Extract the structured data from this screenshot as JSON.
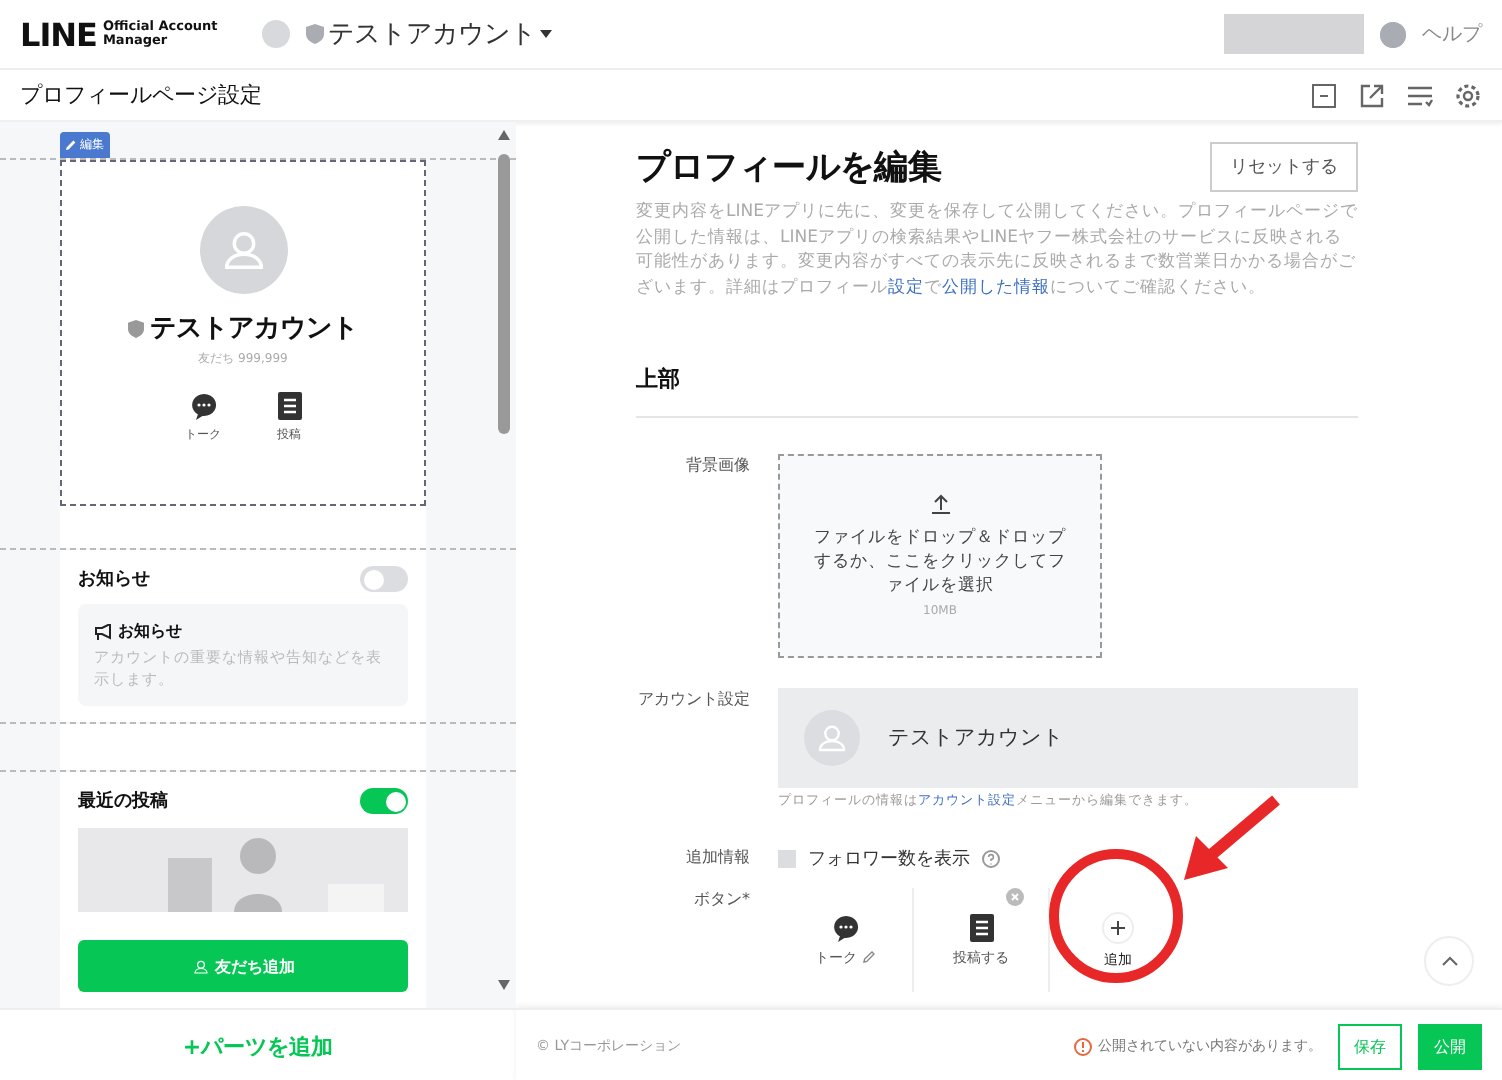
{
  "header": {
    "logo": "LINE",
    "logo_sub": [
      "Official Account",
      "Manager"
    ],
    "account_name": "テストアカウント",
    "help": "ヘルプ"
  },
  "subheader": {
    "title": "プロフィールページ設定"
  },
  "preview": {
    "edit_badge": "編集",
    "profile_name": "テストアカウント",
    "friends": "友だち 999,999",
    "actions": [
      {
        "label": "トーク",
        "kind": "chat"
      },
      {
        "label": "投稿",
        "kind": "post"
      }
    ],
    "notice": {
      "title": "お知らせ",
      "on": false,
      "card_title": "お知らせ",
      "card_text": "アカウントの重要な情報や告知などを表示します。"
    },
    "recent": {
      "title": "最近の投稿",
      "on": true
    },
    "add_friend": "友だち追加"
  },
  "add_parts": "+パーツを追加",
  "editor": {
    "title": "プロフィールを編集",
    "reset": "リセットする",
    "description": [
      {
        "kind": "text",
        "text": "変更内容をLINEアプリに先に、変更を保存して公開してください。プロフィールページで公開した情報は、LINEアプリの検索結果やLINEヤフー株式会社のサービスに反映される可能性があります。変更内容がすべての表示先に反映されるまで数営業日かかる場合がございます。詳細はプロフィール"
      },
      {
        "kind": "link",
        "text": "設定"
      },
      {
        "kind": "text",
        "text": "で"
      },
      {
        "kind": "link",
        "text": "公開した情報"
      },
      {
        "kind": "text",
        "text": "についてご確認ください。"
      }
    ],
    "section": "上部",
    "background_label": "背景画像",
    "dropzone_text": "ファイルをドロップ＆ドロップするか、ここをクリックしてファイルを選択",
    "dropzone_size": "10MB",
    "account_label": "アカウント設定",
    "account_name": "テストアカウント",
    "account_hint": [
      {
        "kind": "text",
        "text": "プロフィールの情報は"
      },
      {
        "kind": "link",
        "text": "アカウント設定"
      },
      {
        "kind": "text",
        "text": "メニューから編集できます。"
      }
    ],
    "extra_label": "追加情報",
    "follower_checkbox": {
      "label": "フォロワー数を表示",
      "checked": false
    },
    "buttons_label": "ボタン*",
    "buttons": [
      {
        "label": "トーク",
        "kind": "chat"
      },
      {
        "label": "投稿する",
        "kind": "post"
      },
      {
        "label": "追加",
        "kind": "add"
      }
    ]
  },
  "footer": {
    "copyright": "© LYコーポレーション",
    "warning": "公開されていない内容があります。",
    "save": "保存",
    "publish": "公開"
  }
}
